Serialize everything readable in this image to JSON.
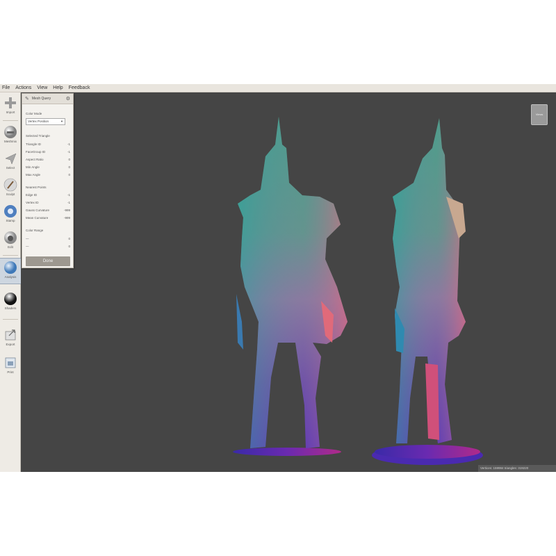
{
  "menu": [
    "File",
    "Actions",
    "View",
    "Help",
    "Feedback"
  ],
  "tools": [
    {
      "label": "Import",
      "icon": "plus-icon"
    },
    {
      "label": "Meshmix",
      "icon": "meshmix-icon"
    },
    {
      "label": "Select",
      "icon": "select-arrow-icon"
    },
    {
      "label": "Sculpt",
      "icon": "brush-icon"
    },
    {
      "label": "Stamp",
      "icon": "stamp-icon"
    },
    {
      "label": "Edit",
      "icon": "edit-sphere-icon"
    },
    {
      "label": "Analysis",
      "icon": "analysis-icon"
    },
    {
      "label": "Shaders",
      "icon": "shaders-sphere-icon"
    },
    {
      "label": "Export",
      "icon": "export-icon"
    },
    {
      "label": "Print",
      "icon": "print-icon"
    }
  ],
  "panel": {
    "title": "Mesh Query",
    "color_mode_label": "Color Mode",
    "color_mode_value": "Vertex Position",
    "selected_triangle_label": "Selected Triangle",
    "triangle_rows": [
      {
        "label": "Triangle ID",
        "value": "-1"
      },
      {
        "label": "FaceGroup ID",
        "value": "-1"
      },
      {
        "label": "Aspect Ratio",
        "value": "0"
      },
      {
        "label": "Min Angle",
        "value": "0"
      },
      {
        "label": "Max Angle",
        "value": "0"
      }
    ],
    "nearest_points_label": "Nearest Points",
    "nearest_rows": [
      {
        "label": "Edge ID",
        "value": "-1"
      },
      {
        "label": "Vertex ID",
        "value": "-1"
      },
      {
        "label": "Gauss Curvature",
        "value": "-999"
      },
      {
        "label": "Mean Curvature",
        "value": "-999"
      }
    ],
    "color_range_label": "Color Range",
    "range_rows": [
      {
        "label": "—",
        "value": "0"
      },
      {
        "label": "—",
        "value": "0"
      }
    ],
    "done_label": "Done"
  },
  "view_button_label": "Views",
  "status_text": "Vertices: 159984 triangles: 319220",
  "colors": {
    "viewport": "#454545",
    "toolbar": "#eeebe5",
    "accent": "#cdd6e0"
  }
}
